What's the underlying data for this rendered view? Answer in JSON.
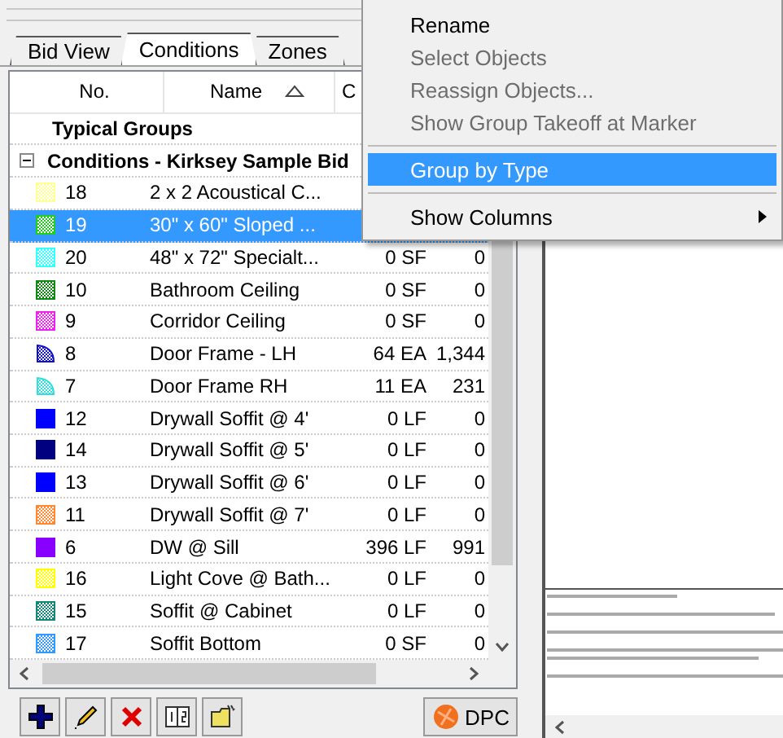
{
  "tabs": [
    {
      "label": "Bid View",
      "selected": false
    },
    {
      "label": "Conditions",
      "selected": true
    },
    {
      "label": "Zones",
      "selected": false
    }
  ],
  "table": {
    "columns": [
      {
        "label": "No.",
        "sorted_ascending": false
      },
      {
        "label": "Name",
        "sorted_ascending": true
      },
      {
        "label": "C",
        "sorted_ascending": false
      }
    ],
    "groups": [
      {
        "title": "Typical Groups",
        "kind": "plain"
      },
      {
        "title": "Conditions - Kirksey Sample Bid",
        "kind": "tree",
        "expanded": true,
        "rows": [
          {
            "no": "18",
            "name": "2 x 2 Acoustical C...",
            "qty": "",
            "column_4": "",
            "color": "#ffff99",
            "kind": "hatched",
            "selected": false
          },
          {
            "no": "19",
            "name": "30\" x 60\" Sloped ...",
            "qty": "",
            "column_4": "",
            "color": "#22cc22",
            "kind": "hatched",
            "selected": true
          },
          {
            "no": "20",
            "name": "48\" x 72\" Specialt...",
            "qty": "0 SF",
            "column_4": "0",
            "color": "#33ffff",
            "kind": "hatched",
            "selected": false
          },
          {
            "no": "10",
            "name": "Bathroom Ceiling",
            "qty": "0 SF",
            "column_4": "0",
            "color": "#118811",
            "kind": "hatched",
            "selected": false
          },
          {
            "no": "9",
            "name": "Corridor Ceiling",
            "qty": "0 SF",
            "column_4": "0",
            "color": "#ee22ee",
            "kind": "hatched",
            "selected": false
          },
          {
            "no": "8",
            "name": "Door Frame - LH",
            "qty": "64 EA",
            "column_4": "1,344",
            "color": "#1111cc",
            "kind": "door",
            "selected": false
          },
          {
            "no": "7",
            "name": "Door Frame RH",
            "qty": "11 EA",
            "column_4": "231",
            "color": "#33dddd",
            "kind": "door",
            "selected": false
          },
          {
            "no": "12",
            "name": "Drywall Soffit @ 4'",
            "qty": "0 LF",
            "column_4": "0",
            "color": "#0000ff",
            "kind": "solid",
            "selected": false
          },
          {
            "no": "14",
            "name": "Drywall Soffit @ 5'",
            "qty": "0 LF",
            "column_4": "0",
            "color": "#000080",
            "kind": "solid",
            "selected": false
          },
          {
            "no": "13",
            "name": "Drywall Soffit @ 6'",
            "qty": "0 LF",
            "column_4": "0",
            "color": "#0000ff",
            "kind": "solid",
            "selected": false
          },
          {
            "no": "11",
            "name": "Drywall Soffit @ 7'",
            "qty": "0 LF",
            "column_4": "0",
            "color": "#ff8833",
            "kind": "hatched",
            "selected": false
          },
          {
            "no": "6",
            "name": "DW @ Sill",
            "qty": "396 LF",
            "column_4": "991",
            "color": "#8800ff",
            "kind": "solid",
            "selected": false
          },
          {
            "no": "16",
            "name": "Light Cove @ Bath...",
            "qty": "0 LF",
            "column_4": "0",
            "color": "#ffff00",
            "kind": "hatched",
            "selected": false
          },
          {
            "no": "15",
            "name": "Soffit @ Cabinet",
            "qty": "0 LF",
            "column_4": "0",
            "color": "#118877",
            "kind": "hatched",
            "selected": false
          },
          {
            "no": "17",
            "name": "Soffit Bottom",
            "qty": "0 SF",
            "column_4": "0",
            "color": "#3399ff",
            "kind": "hatched",
            "selected": false
          }
        ]
      }
    ]
  },
  "toolbar": [
    {
      "kind": "add"
    },
    {
      "kind": "edit"
    },
    {
      "kind": "delete"
    },
    {
      "kind": "renumber"
    },
    {
      "kind": "new-folder"
    }
  ],
  "dpc_button": {
    "label": "DPC"
  },
  "context_menu": [
    {
      "kind": "item",
      "label": "Rename",
      "disabled": false,
      "highlighted": false,
      "submenu": false
    },
    {
      "kind": "item",
      "label": "Select Objects",
      "disabled": true,
      "highlighted": false,
      "submenu": false
    },
    {
      "kind": "item",
      "label": "Reassign Objects...",
      "disabled": true,
      "highlighted": false,
      "submenu": false
    },
    {
      "kind": "item",
      "label": "Show Group Takeoff at Marker",
      "disabled": true,
      "highlighted": false,
      "submenu": false
    },
    {
      "kind": "separator"
    },
    {
      "kind": "item",
      "label": "Group by Type",
      "disabled": false,
      "highlighted": true,
      "submenu": false
    },
    {
      "kind": "separator"
    },
    {
      "kind": "item",
      "label": "Show Columns",
      "disabled": false,
      "highlighted": false,
      "submenu": true
    }
  ]
}
